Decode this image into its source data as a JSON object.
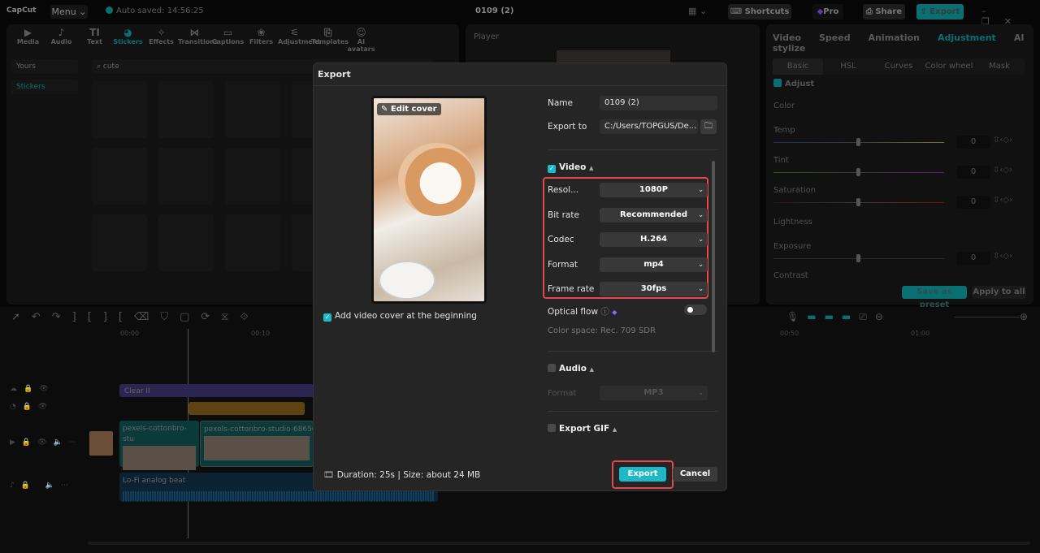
{
  "app": {
    "logo": "CapCut",
    "menu": "Menu",
    "autosave": "Auto saved: 14:56:25",
    "project_title": "0109 (2)",
    "shortcuts": "Shortcuts",
    "pro": "Pro",
    "share": "Share",
    "export": "Export",
    "accent": "#1fb8c6"
  },
  "toolbar": [
    {
      "label": "Media",
      "icon": "media-icon",
      "glyph": "▶"
    },
    {
      "label": "Audio",
      "icon": "audio-icon",
      "glyph": "♪"
    },
    {
      "label": "Text",
      "icon": "text-icon",
      "glyph": "TI"
    },
    {
      "label": "Stickers",
      "icon": "stickers-icon",
      "glyph": "◕",
      "active": true
    },
    {
      "label": "Effects",
      "icon": "effects-icon",
      "glyph": "✧"
    },
    {
      "label": "Transitions",
      "icon": "transitions-icon",
      "glyph": "⋈"
    },
    {
      "label": "Captions",
      "icon": "captions-icon",
      "glyph": "▭"
    },
    {
      "label": "Filters",
      "icon": "filters-icon",
      "glyph": "❀"
    },
    {
      "label": "Adjustment",
      "icon": "adjustment-icon",
      "glyph": "⚟"
    },
    {
      "label": "Templates",
      "icon": "templates-icon",
      "glyph": "⎘"
    },
    {
      "label": "AI avatars",
      "icon": "ai-avatars-icon",
      "glyph": "☺"
    }
  ],
  "library": {
    "filter": "Yours",
    "category": "Stickers",
    "search": "cute"
  },
  "player": {
    "title": "Player"
  },
  "right_panel": {
    "tabs": [
      "Video",
      "Speed",
      "Animation",
      "Adjustment",
      "AI stylize"
    ],
    "active_tab": "Adjustment",
    "sub_tabs": [
      "Basic",
      "HSL",
      "Curves",
      "Color wheel",
      "Mask"
    ],
    "section": "Adjust",
    "color_group": "Color",
    "sliders": [
      {
        "label": "Temp",
        "value": "0"
      },
      {
        "label": "Tint",
        "value": "0"
      },
      {
        "label": "Saturation",
        "value": "0"
      }
    ],
    "lightness_group": "Lightness",
    "exposure": {
      "label": "Exposure",
      "value": "0"
    },
    "contrast": "Contrast",
    "save_preset": "Save as preset",
    "apply_all": "Apply to all"
  },
  "timeline": {
    "ticks": [
      "00:00",
      "00:10",
      "00:50",
      "01:00"
    ],
    "tracks": {
      "filter_clip": "Clear II",
      "video_clip_1": "pexels-cottonbro-stu",
      "video_clip_2": "pexels-cottonbro-studio-68650",
      "audio_clip": "Lo-Fi analog beat"
    }
  },
  "export_dialog": {
    "title": "Export",
    "edit_cover": "Edit cover",
    "add_cover": "Add video cover at the beginning",
    "add_cover_checked": true,
    "info": "Duration: 25s | Size: about 24 MB",
    "name_label": "Name",
    "name_value": "0109 (2)",
    "export_to_label": "Export to",
    "export_to_value": "C:/Users/TOPGUS/De...",
    "video": {
      "label": "Video",
      "checked": true,
      "resolution_label": "Resol...",
      "resolution": "1080P",
      "bitrate_label": "Bit rate",
      "bitrate": "Recommended",
      "codec_label": "Codec",
      "codec": "H.264",
      "format_label": "Format",
      "format": "mp4",
      "framerate_label": "Frame rate",
      "framerate": "30fps",
      "optical_flow": "Optical flow",
      "optical_flow_on": false,
      "color_space": "Color space: Rec. 709 SDR"
    },
    "audio": {
      "label": "Audio",
      "checked": false,
      "format_label": "Format",
      "format": "MP3"
    },
    "gif": {
      "label": "Export GIF",
      "checked": false
    },
    "export_button": "Export",
    "cancel_button": "Cancel",
    "highlight_color": "#e5484d"
  }
}
